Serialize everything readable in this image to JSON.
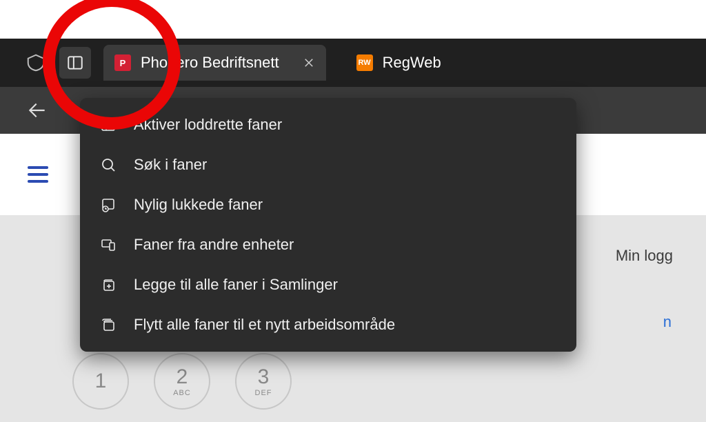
{
  "tabs": [
    {
      "title": "Phonero Bedriftsnett",
      "favicon_text": "P",
      "favicon_class": "p",
      "active": true
    },
    {
      "title": "RegWeb",
      "favicon_text": "RW",
      "favicon_class": "rw",
      "active": false
    }
  ],
  "menu": {
    "items": [
      {
        "label": "Aktiver loddrette faner",
        "icon": "panel-icon"
      },
      {
        "label": "Søk i faner",
        "icon": "search-icon"
      },
      {
        "label": "Nylig lukkede faner",
        "icon": "history-icon"
      },
      {
        "label": "Faner fra andre enheter",
        "icon": "devices-icon"
      },
      {
        "label": "Legge til alle faner i Samlinger",
        "icon": "collections-add-icon"
      },
      {
        "label": "Flytt alle faner til et nytt arbeidsområde",
        "icon": "workspace-move-icon"
      }
    ]
  },
  "page": {
    "minlogg": "Min logg",
    "blue_fragment": "n"
  },
  "keypad": [
    {
      "num": "1",
      "letters": ""
    },
    {
      "num": "2",
      "letters": "ABC"
    },
    {
      "num": "3",
      "letters": "DEF"
    }
  ]
}
